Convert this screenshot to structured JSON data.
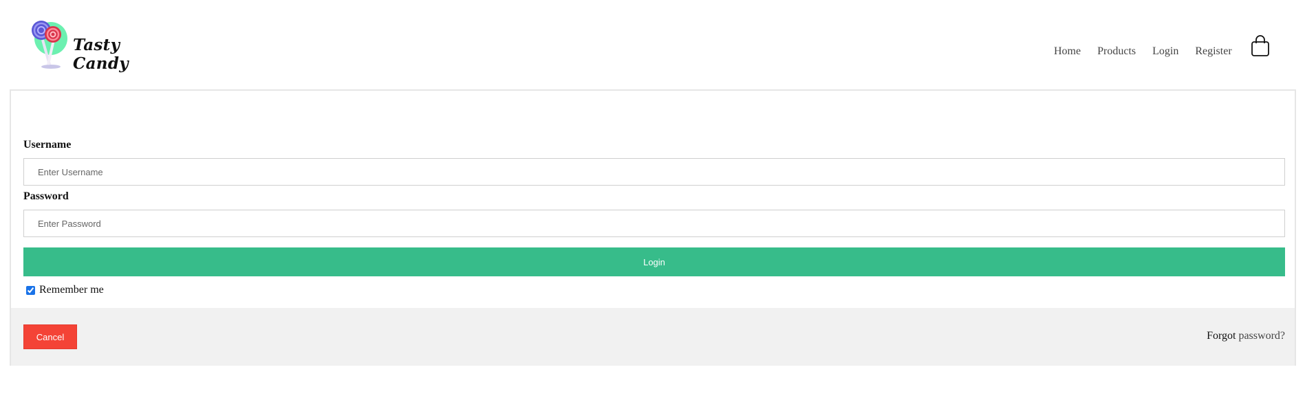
{
  "brand": {
    "name": "Tasty Candy"
  },
  "nav": {
    "items": [
      {
        "label": "Home"
      },
      {
        "label": "Products"
      },
      {
        "label": "Login"
      },
      {
        "label": "Register"
      }
    ],
    "cart_icon": "shopping-bag-icon"
  },
  "form": {
    "username": {
      "label": "Username",
      "placeholder": "Enter Username",
      "value": ""
    },
    "password": {
      "label": "Password",
      "placeholder": "Enter Password",
      "value": ""
    },
    "login_label": "Login",
    "remember": {
      "label": "Remember me",
      "checked": true
    }
  },
  "footer": {
    "cancel_label": "Cancel",
    "forgot_prefix": "Forgot",
    "forgot_link": "password?"
  },
  "colors": {
    "login_button": "#37bc8a",
    "cancel_button": "#f44336",
    "footer_bg": "#f1f1f1"
  }
}
